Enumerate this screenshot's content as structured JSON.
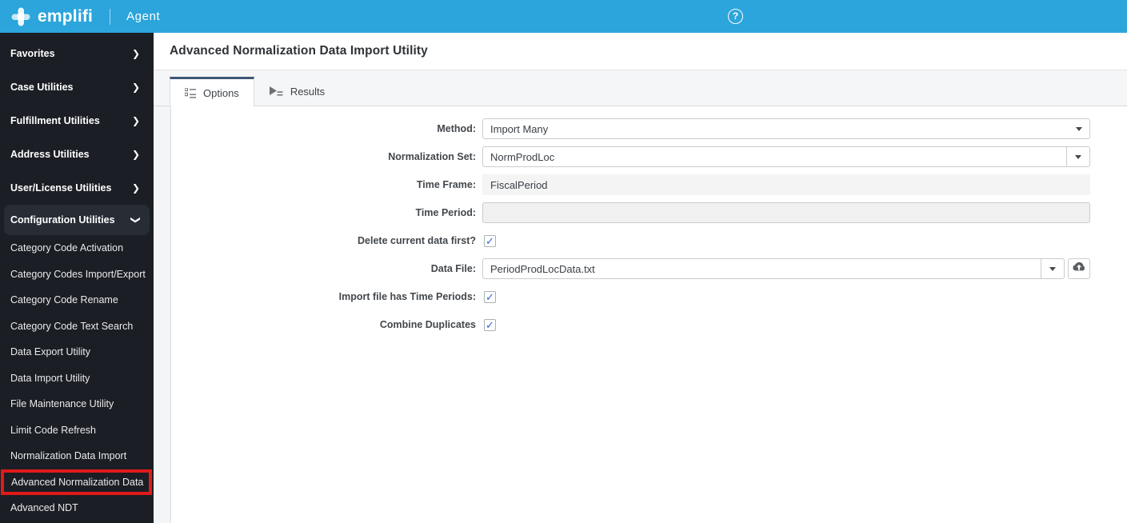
{
  "topbar": {
    "brand": "emplifi",
    "product": "Agent"
  },
  "sidebar": {
    "groups": [
      {
        "label": "Favorites"
      },
      {
        "label": "Case Utilities"
      },
      {
        "label": "Fulfillment Utilities"
      },
      {
        "label": "Address Utilities"
      },
      {
        "label": "User/License Utilities"
      },
      {
        "label": "Configuration Utilities"
      }
    ],
    "items": [
      {
        "label": "Category Code Activation"
      },
      {
        "label": "Category Codes Import/Export"
      },
      {
        "label": "Category Code Rename"
      },
      {
        "label": "Category Code Text Search"
      },
      {
        "label": "Data Export Utility"
      },
      {
        "label": "Data Import Utility"
      },
      {
        "label": "File Maintenance Utility"
      },
      {
        "label": "Limit Code Refresh"
      },
      {
        "label": "Normalization Data Import"
      },
      {
        "label": "Advanced Normalization Data"
      },
      {
        "label": "Advanced NDT"
      }
    ]
  },
  "main": {
    "title": "Advanced Normalization Data Import Utility",
    "tabs": {
      "options": "Options",
      "results": "Results"
    },
    "form": {
      "method": {
        "label": "Method:",
        "value": "Import Many"
      },
      "normalization_set": {
        "label": "Normalization Set:",
        "value": "NormProdLoc"
      },
      "time_frame": {
        "label": "Time Frame:",
        "value": "FiscalPeriod"
      },
      "time_period": {
        "label": "Time Period:",
        "value": ""
      },
      "delete_first": {
        "label": "Delete current data first?",
        "checked": true
      },
      "data_file": {
        "label": "Data File:",
        "value": "PeriodProdLocData.txt"
      },
      "import_periods": {
        "label": "Import file has Time Periods:",
        "checked": true
      },
      "combine_duplicates": {
        "label": "Combine Duplicates",
        "checked": true
      }
    }
  },
  "colors": {
    "topbar_blue": "#2BA5DB",
    "sidebar_bg": "#1B1E24",
    "sidebar_active_bg": "#272C35",
    "tab_accent": "#3D5878",
    "checkbox_blue": "#2B5FD9",
    "annotation_red": "#E01A1A"
  }
}
